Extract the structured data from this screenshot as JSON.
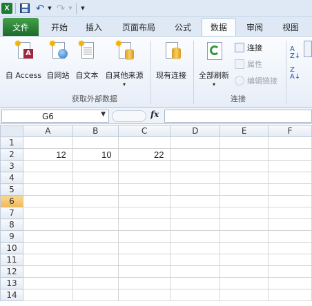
{
  "qat": {
    "logo": "X",
    "undo": "↶",
    "redo": "↷",
    "customize": "▼"
  },
  "tabs": [
    {
      "label": "文件"
    },
    {
      "label": "开始"
    },
    {
      "label": "插入"
    },
    {
      "label": "页面布局"
    },
    {
      "label": "公式"
    },
    {
      "label": "数据",
      "active": true
    },
    {
      "label": "审阅"
    },
    {
      "label": "视图"
    }
  ],
  "ribbon": {
    "get_external": {
      "buttons": [
        "自 Access",
        "自网站",
        "自文本",
        "自其他来源"
      ],
      "more_arrow": "▾",
      "label": "获取外部数据"
    },
    "existing": "现有连接",
    "connections": {
      "refresh_all": "全部刷新",
      "refresh_arrow": "▾",
      "items": [
        "连接",
        "属性",
        "编辑链接"
      ],
      "label": "连接"
    }
  },
  "formula_bar": {
    "namebox": "G6",
    "fx": "fx",
    "value": ""
  },
  "grid": {
    "columns": [
      "A",
      "B",
      "C",
      "D",
      "E",
      "F"
    ],
    "rows": [
      "1",
      "2",
      "3",
      "4",
      "5",
      "6",
      "7",
      "8",
      "9",
      "10",
      "11",
      "12",
      "13",
      "14"
    ],
    "selected_row": "6",
    "cells": {
      "A2": "12",
      "B2": "10",
      "C2": "22"
    }
  }
}
